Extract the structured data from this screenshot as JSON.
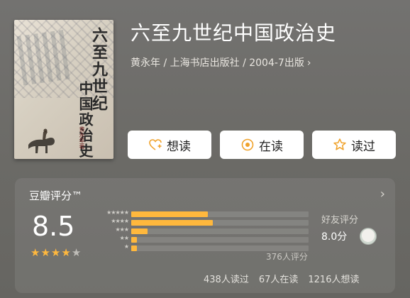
{
  "book": {
    "title": "六至九世纪中国政治史",
    "meta": "黄永年 / 上海书店出版社 / 2004-7出版",
    "cover_text_line1": "六至九世纪",
    "cover_text_line2": "中国政治史",
    "cover_author": "黄永年著"
  },
  "actions": {
    "want": "想读",
    "reading": "在读",
    "read": "读过"
  },
  "rating": {
    "panel_title": "豆瓣评分™",
    "score": "8.5",
    "stars_filled": 4,
    "stars_total": 5,
    "ratings_count": "376人评分",
    "distribution": [
      {
        "stars": 5,
        "fraction": 0.43
      },
      {
        "stars": 4,
        "fraction": 0.46
      },
      {
        "stars": 3,
        "fraction": 0.09
      },
      {
        "stars": 2,
        "fraction": 0.03
      },
      {
        "stars": 1,
        "fraction": 0.03
      }
    ],
    "friend_label": "好友评分",
    "friend_score": "8.0分"
  },
  "stats": {
    "read": "438人读过",
    "reading": "67人在读",
    "want": "1216人想读"
  },
  "colors": {
    "accent": "#ffb83d",
    "background": "#6f6e6a"
  }
}
